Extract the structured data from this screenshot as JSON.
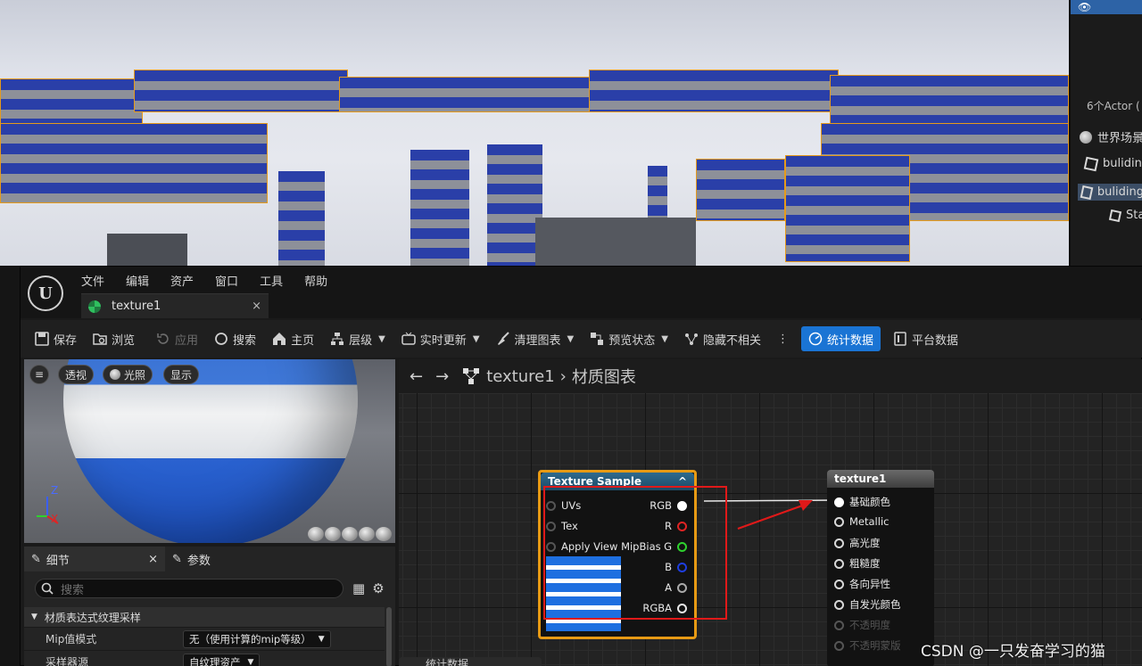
{
  "outliner": {
    "actor_count": "6个Actor (",
    "items": [
      {
        "label": "世界场景",
        "icon": "globe-icon"
      },
      {
        "label": "buliding",
        "icon": "cube-icon"
      },
      {
        "label": "buliding",
        "icon": "cube-icon",
        "selected": true
      },
      {
        "label": "Sta",
        "icon": "cube-icon"
      }
    ]
  },
  "editor": {
    "logo": "U",
    "menu": [
      "文件",
      "编辑",
      "资产",
      "窗口",
      "工具",
      "帮助"
    ],
    "tab": {
      "label": "texture1",
      "close": "×"
    },
    "toolbar": {
      "save": "保存",
      "browse": "浏览",
      "apply": "应用",
      "search": "搜索",
      "home": "主页",
      "hierarchy": "层级",
      "live_update": "实时更新",
      "clean_graph": "清理图表",
      "preview_state": "预览状态",
      "hide_unrelated": "隐藏不相关",
      "stats": "统计数据",
      "platform_stats": "平台数据"
    },
    "preview": {
      "menu_icon": "≡",
      "perspective": "透视",
      "lighting": "光照",
      "show": "显示",
      "axis_z": "Z",
      "axis_x": "X"
    },
    "details": {
      "tab_details": "细节",
      "tab_close": "×",
      "tab_params": "参数",
      "search_placeholder": "搜索",
      "section": "材质表达式纹理采样",
      "props": [
        {
          "key": "Mip值模式",
          "value": "无（使用计算的mip等级）"
        },
        {
          "key": "采样器源",
          "value": "自纹理资产"
        }
      ]
    },
    "graph": {
      "breadcrumb_asset": "texture1",
      "breadcrumb_graph": "材质图表",
      "texture_node": {
        "title": "Texture Sample",
        "inputs": [
          "UVs",
          "Tex",
          "Apply View MipBias"
        ],
        "outputs": [
          "RGB",
          "R",
          "G",
          "B",
          "A",
          "RGBA"
        ]
      },
      "result_node": {
        "title": "texture1",
        "inputs": [
          "基础颜色",
          "Metallic",
          "高光度",
          "粗糙度",
          "各向异性",
          "自发光颜色",
          "不透明度",
          "不透明蒙版"
        ]
      }
    },
    "stats_tab": "统计数据"
  },
  "watermark": "CSDN @一只发奋学习的猫",
  "colors": {
    "accent": "#1a74d4",
    "node_border": "#e79a14",
    "highlight_box": "#e01919",
    "pin_r": "#e02424",
    "pin_g": "#2ed12e",
    "pin_b": "#1e3ee0"
  }
}
